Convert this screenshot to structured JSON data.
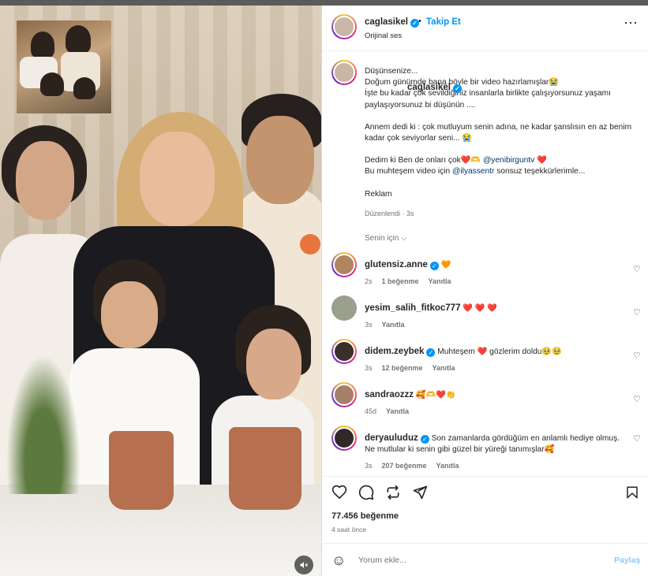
{
  "header": {
    "username": "caglasikel",
    "separator": "•",
    "follow_label": "Takip Et",
    "audio": "Orijinal ses",
    "more_icon": "more-horizontal-icon"
  },
  "caption": {
    "username": "caglasikel",
    "lines": [
      "Düşünsenize...",
      "Doğum günümde bana böyle bir video hazırlamışlar😭",
      "İşte bu kadar çok sevildiğiniz insanlarla birlikte çalışıyorsunuz yaşamı paylaşıyorsunuz bi düşünün ....",
      "",
      "Annem dedi ki : çok mutluyum senin adına, ne kadar şanslısın en az benim kadar çok seviyorlar seni... 😭",
      "",
      "Dedim ki Ben de onları çok❤️🫶 @yenibirguntv ❤️",
      "Bu muhteşem video için @ilyassentr sonsuz teşekkürlerimle...",
      "",
      "Reklam"
    ],
    "line7_parts": [
      "Dedim ki Ben de onları çok❤️🫶 ",
      "@yenibirguntv",
      " ❤️"
    ],
    "line8_parts": [
      "Bu muhteşem video için ",
      "@ilyassentr",
      " sonsuz teşekkürlerimle..."
    ],
    "meta": "Düzenlendi · 3s"
  },
  "for_you": "Senin için ⌵",
  "comments": [
    {
      "username": "glutensiz.anne",
      "verified": true,
      "text": "🧡",
      "time": "2s",
      "likes": "1 beğenme",
      "reply": "Yanıtla"
    },
    {
      "username": "yesim_salih_fitkoc777",
      "verified": false,
      "text": "❤️ ❤️ ❤️",
      "time": "3s",
      "likes": "",
      "reply": "Yanıtla"
    },
    {
      "username": "didem.zeybek",
      "verified": true,
      "text": "Muhteşem ❤️ gözlerim doldu🥹🥹",
      "time": "3s",
      "likes": "12 beğenme",
      "reply": "Yanıtla"
    },
    {
      "username": "sandraozzz",
      "verified": false,
      "text": "🥰🫶❤️👏",
      "time": "45d",
      "likes": "",
      "reply": "Yanıtla"
    },
    {
      "username": "deryauluduz",
      "verified": true,
      "text": "Son zamanlarda gördüğüm en anlamlı hediye olmuş. Ne mutlular ki senin gibi güzel bir yüreği tanımışlar🥰",
      "time": "3s",
      "likes": "207 beğenme",
      "reply": "Yanıtla"
    }
  ],
  "actions": {
    "like_icon": "heart-icon",
    "comment_icon": "comment-icon",
    "repost_icon": "repost-icon",
    "share_icon": "share-icon",
    "save_icon": "bookmark-icon"
  },
  "likes": "77.456 beğenme",
  "posted": "4 saat önce",
  "add_comment": {
    "placeholder": "Yorum ekle...",
    "post_label": "Paylaş"
  },
  "colors": {
    "accent": "#0095f6",
    "text": "#262626",
    "muted": "#737373"
  }
}
